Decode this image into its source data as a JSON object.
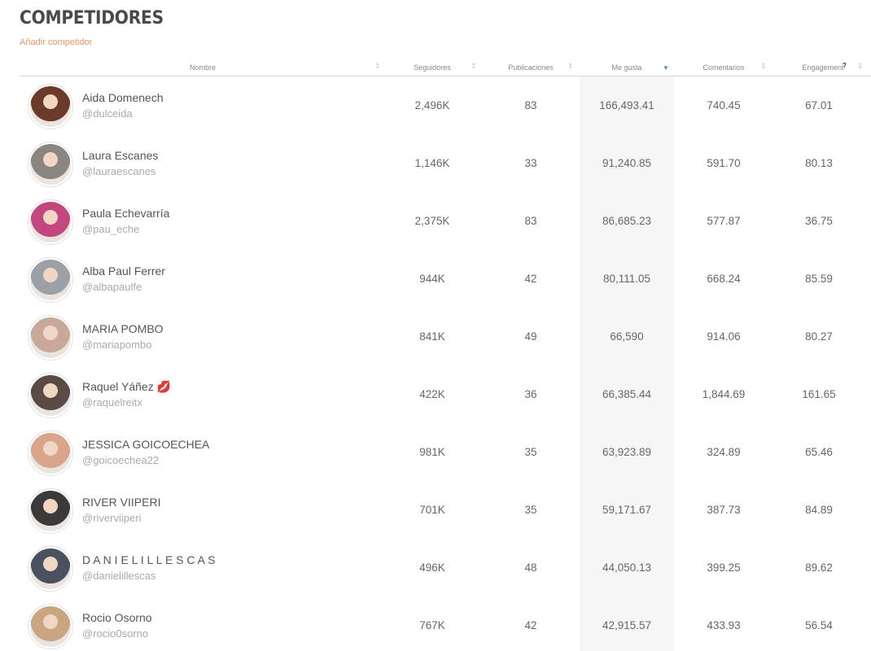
{
  "page": {
    "title": "COMPETIDORES",
    "add_competitor": "Añadir competidor"
  },
  "columns": {
    "nombre": "Nombre",
    "seguidores": "Seguidores",
    "publicaciones": "Publicaciones",
    "me_gusta": "Me gusta",
    "comentarios": "Comentarios",
    "engagement": "Engagement"
  },
  "icons": {
    "sort": "sort-updown-icon",
    "sort_active": "sort-down-icon",
    "help": "help-icon"
  },
  "colors": {
    "accent_link": "#e8956a",
    "sort_active": "#4a8fc4",
    "highlight_column": "#f6f6f6"
  },
  "rows": [
    {
      "name": "Aida Domenech",
      "handle": "@dulceida",
      "followers": "2,496K",
      "posts": "83",
      "likes": "166,493.41",
      "comments": "740.45",
      "engagement": "67.01",
      "avatar": "#6b3a2a"
    },
    {
      "name": "Laura Escanes",
      "handle": "@lauraescanes",
      "followers": "1,146K",
      "posts": "33",
      "likes": "91,240.85",
      "comments": "591.70",
      "engagement": "80.13",
      "avatar": "#8a8580"
    },
    {
      "name": "Paula Echevarría",
      "handle": "@pau_eche",
      "followers": "2,375K",
      "posts": "83",
      "likes": "86,685.23",
      "comments": "577.87",
      "engagement": "36.75",
      "avatar": "#c4467f"
    },
    {
      "name": "Alba Paul Ferrer",
      "handle": "@albapaulfe",
      "followers": "944K",
      "posts": "42",
      "likes": "80,111.05",
      "comments": "668.24",
      "engagement": "85.59",
      "avatar": "#9aa0a6"
    },
    {
      "name": "MARIA POMBO",
      "handle": "@mariapombo",
      "followers": "841K",
      "posts": "49",
      "likes": "66,590",
      "comments": "914.06",
      "engagement": "80.27",
      "avatar": "#c8a898"
    },
    {
      "name": "Raquel Yáñez 💋",
      "handle": "@raquelreitx",
      "followers": "422K",
      "posts": "36",
      "likes": "66,385.44",
      "comments": "1,844.69",
      "engagement": "161.65",
      "avatar": "#5a4a44"
    },
    {
      "name": "JESSICA GOICOECHEA",
      "handle": "@goicoechea22",
      "followers": "981K",
      "posts": "35",
      "likes": "63,923.89",
      "comments": "324.89",
      "engagement": "65.46",
      "avatar": "#d9a48a"
    },
    {
      "name": "RIVER VIIPERI",
      "handle": "@riverviiperi",
      "followers": "701K",
      "posts": "35",
      "likes": "59,171.67",
      "comments": "387.73",
      "engagement": "84.89",
      "avatar": "#3a3a3a"
    },
    {
      "name": "D A N I E L I L L E S C A S",
      "handle": "@danielillescas",
      "followers": "496K",
      "posts": "48",
      "likes": "44,050.13",
      "comments": "399.25",
      "engagement": "89.62",
      "avatar": "#4a5260"
    },
    {
      "name": "Rocio Osorno",
      "handle": "@rocio0sorno",
      "followers": "767K",
      "posts": "42",
      "likes": "42,915.57",
      "comments": "433.93",
      "engagement": "56.54",
      "avatar": "#c9a582"
    }
  ]
}
